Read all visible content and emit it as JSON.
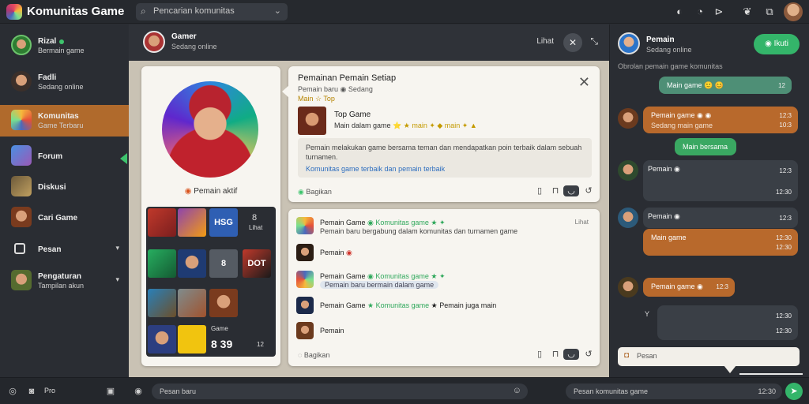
{
  "app": {
    "title": "Komunitas Game"
  },
  "search": {
    "placeholder": "Pencarian komunitas"
  },
  "sidebar": {
    "items": [
      {
        "name": "Rizal",
        "sub": "Bermain game"
      },
      {
        "name": "Fadli",
        "sub": "Sedang online"
      },
      {
        "name": "Komunitas",
        "sub": "Game Terbaru"
      },
      {
        "name": "Forum",
        "sub": ""
      },
      {
        "name": "Diskusi",
        "sub": ""
      },
      {
        "name": "Cari Game",
        "sub": ""
      },
      {
        "name": "Pesan",
        "sub": ""
      },
      {
        "name": "Pengaturan",
        "sub": "Tampilan akun"
      }
    ]
  },
  "center": {
    "header": {
      "name": "Gamer",
      "sub": "Sedang online",
      "action": "Lihat"
    },
    "profile": {
      "caption": "Pemain aktif"
    },
    "games": {
      "tiles": [
        "",
        "",
        "HSG",
        "8",
        "",
        "",
        "8",
        "DOT",
        "",
        "",
        "",
        "",
        "",
        ""
      ],
      "side_label_1": "Game",
      "side_label_2": "Lihat",
      "score": "8 39",
      "score_side": "12"
    },
    "post": {
      "title": "Pemainan Pemain Setiap",
      "meta": "Pemain baru ◉ Sedang",
      "meta2": "Main ☆ Top",
      "game_name": "Top Game",
      "game_tags": "Main dalam game ",
      "game_tags_hl": "⭐ ★ main ✦ ◆ main ✦ ▲",
      "quote_text": "Pemain melakukan game bersama teman dan mendapatkan poin terbaik dalam sebuah turnamen.",
      "quote_link": "Komunitas game terbaik dan pemain terbaik",
      "footer": "Bagikan"
    },
    "feed": {
      "rows": [
        {
          "title": "Pemain Game ",
          "hl": "◉ Komunitas game ★ ✦",
          "sub": "Pemain baru bergabung dalam komunitas dan turnamen game",
          "right": "Lihat"
        },
        {
          "title": "Pemain ",
          "hl_red": "◉",
          "sub": "",
          "right": ""
        },
        {
          "title": "Pemain Game ",
          "hl": "◉ Komunitas game ★ ✦",
          "sub_pill": "Pemain baru bermain dalam game",
          "right": ""
        },
        {
          "title": "Pemain Game ",
          "hl": "★ Komunitas game",
          "tail": " ★ Pemain juga main",
          "sub": "",
          "right": ""
        },
        {
          "title": "Pemain",
          "sub": "",
          "right": ""
        }
      ],
      "footer": "Bagikan"
    }
  },
  "right": {
    "header": {
      "name": "Pemain",
      "sub": "Sedang online",
      "button": "Ikuti"
    },
    "meta": "Obrolan pemain game komunitas",
    "messages": [
      {
        "text": "Main game 🙂 😊",
        "time": "12",
        "style": "green"
      },
      {
        "text": "Pemain game ◉ ◉",
        "sub": "Sedang main game",
        "time": "12:3",
        "time2": "10:3",
        "style": "orange"
      },
      {
        "text": "Main bersama",
        "time": "",
        "style": "bright"
      },
      {
        "text": "Pemain ◉",
        "time": "12:3",
        "time2": "12:30",
        "style": "slate"
      },
      {
        "text": "Pemain ◉",
        "time": "12:3",
        "style": "slate"
      },
      {
        "text": "Main game",
        "time": "12:30",
        "time2": "12:30",
        "style": "orange"
      },
      {
        "text": "Pemain game ◉",
        "time": "12:3",
        "style": "orange"
      },
      {
        "text": "Y",
        "time": "12:30",
        "time2": "12:30",
        "style": "slate"
      }
    ],
    "input_placeholder": "Pesan"
  },
  "bottom": {
    "label_1": "Pro",
    "input_placeholder": "Pesan baru",
    "right_input_placeholder": "Pesan komunitas game",
    "right_input_badge": "12:30"
  }
}
